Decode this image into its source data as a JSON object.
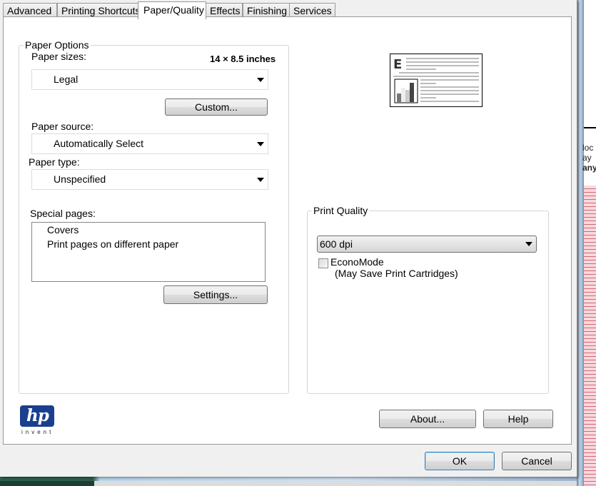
{
  "tabs": [
    {
      "label": "Advanced",
      "active": false
    },
    {
      "label": "Printing Shortcuts",
      "active": false
    },
    {
      "label": "Paper/Quality",
      "active": true
    },
    {
      "label": "Effects",
      "active": false
    },
    {
      "label": "Finishing",
      "active": false
    },
    {
      "label": "Services",
      "active": false
    }
  ],
  "paper_options": {
    "group_label": "Paper Options",
    "paper_sizes_label": "Paper sizes:",
    "paper_size_dimensions": "14 × 8.5 inches",
    "paper_size_value": "Legal",
    "custom_button": "Custom...",
    "paper_source_label": "Paper source:",
    "paper_source_value": "Automatically Select",
    "paper_type_label": "Paper type:",
    "paper_type_value": "Unspecified",
    "special_pages_label": "Special pages:",
    "special_pages_items": [
      "Covers",
      "Print pages on different paper"
    ],
    "settings_button": "Settings..."
  },
  "print_quality": {
    "group_label": "Print Quality",
    "resolution_value": "600 dpi",
    "economode_label": "EconoMode",
    "economode_note": "(May Save Print Cartridges)",
    "economode_checked": false
  },
  "logo": {
    "brand": "hp",
    "tagline": "invent",
    "color": "#1a3f8f"
  },
  "buttons": {
    "about": "About...",
    "help": "Help",
    "ok": "OK",
    "cancel": "Cancel"
  },
  "background_window": {
    "fragments": [
      "loc",
      "ay",
      "any"
    ]
  }
}
